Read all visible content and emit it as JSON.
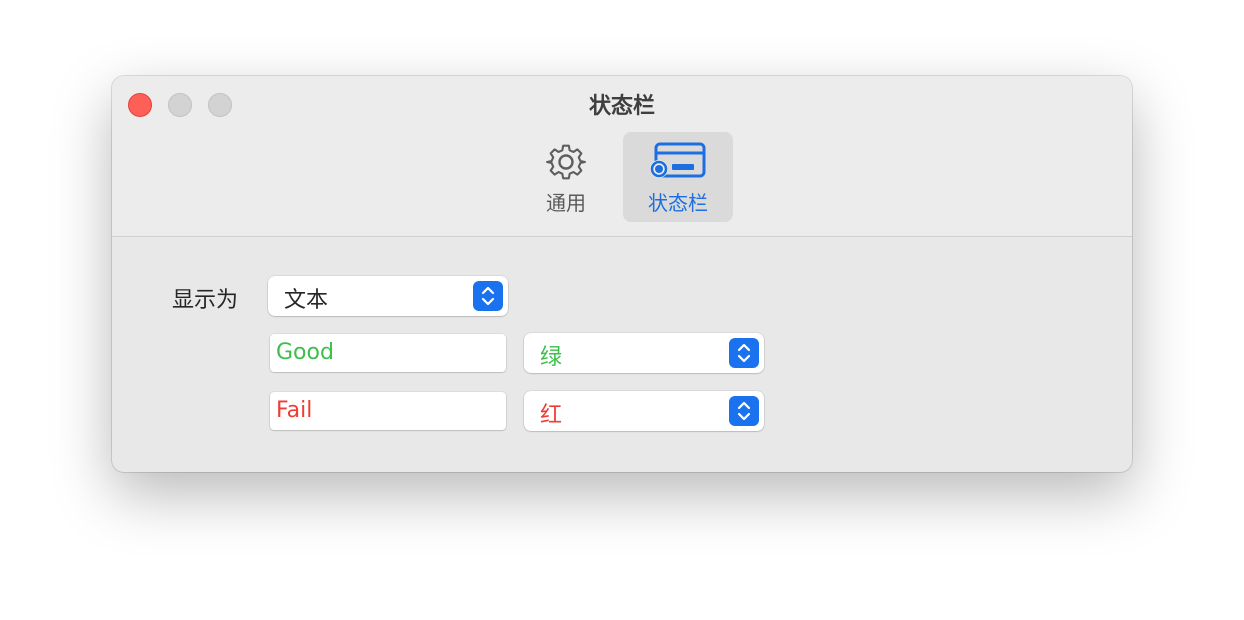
{
  "window": {
    "title": "状态栏"
  },
  "toolbar": {
    "tabs": [
      {
        "label": "通用",
        "icon": "gear-icon",
        "selected": false
      },
      {
        "label": "状态栏",
        "icon": "status-bar-icon",
        "selected": true
      }
    ]
  },
  "form": {
    "display_as": {
      "label": "显示为",
      "value": "文本"
    },
    "good": {
      "text": "Good",
      "color_value": "绿",
      "text_color": "#3cc04a"
    },
    "fail": {
      "text": "Fail",
      "color_value": "红",
      "text_color": "#ef3d35"
    }
  },
  "colors": {
    "accent": "#1b72ef",
    "close": "#fe5f57"
  }
}
